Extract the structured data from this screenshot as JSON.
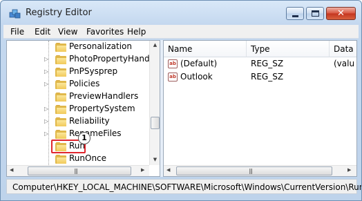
{
  "window": {
    "title": "Registry Editor"
  },
  "menu": [
    "File",
    "Edit",
    "View",
    "Favorites",
    "Help"
  ],
  "tree": {
    "items": [
      {
        "label": "Personalization",
        "has_children": false
      },
      {
        "label": "PhotoPropertyHandle",
        "has_children": true
      },
      {
        "label": "PnPSysprep",
        "has_children": true
      },
      {
        "label": "Policies",
        "has_children": true
      },
      {
        "label": "PreviewHandlers",
        "has_children": false
      },
      {
        "label": "PropertySystem",
        "has_children": true
      },
      {
        "label": "Reliability",
        "has_children": true
      },
      {
        "label": "RenameFiles",
        "has_children": true
      },
      {
        "label": "Run",
        "has_children": false,
        "selected": true
      },
      {
        "label": "RunOnce",
        "has_children": false
      }
    ]
  },
  "list": {
    "columns": [
      "Name",
      "Type",
      "Data"
    ],
    "rows": [
      {
        "name": "(Default)",
        "type": "REG_SZ",
        "data": "(valu"
      },
      {
        "name": "Outlook",
        "type": "REG_SZ",
        "data": ""
      }
    ]
  },
  "status": {
    "path": "Computer\\HKEY_LOCAL_MACHINE\\SOFTWARE\\Microsoft\\Windows\\CurrentVersion\\Run"
  },
  "annotation": {
    "step_number": "1",
    "color": "#e0262d"
  },
  "icons": {
    "app": "registry-editor-icon",
    "folder": "folder-icon",
    "value": "reg-sz-value-icon"
  }
}
